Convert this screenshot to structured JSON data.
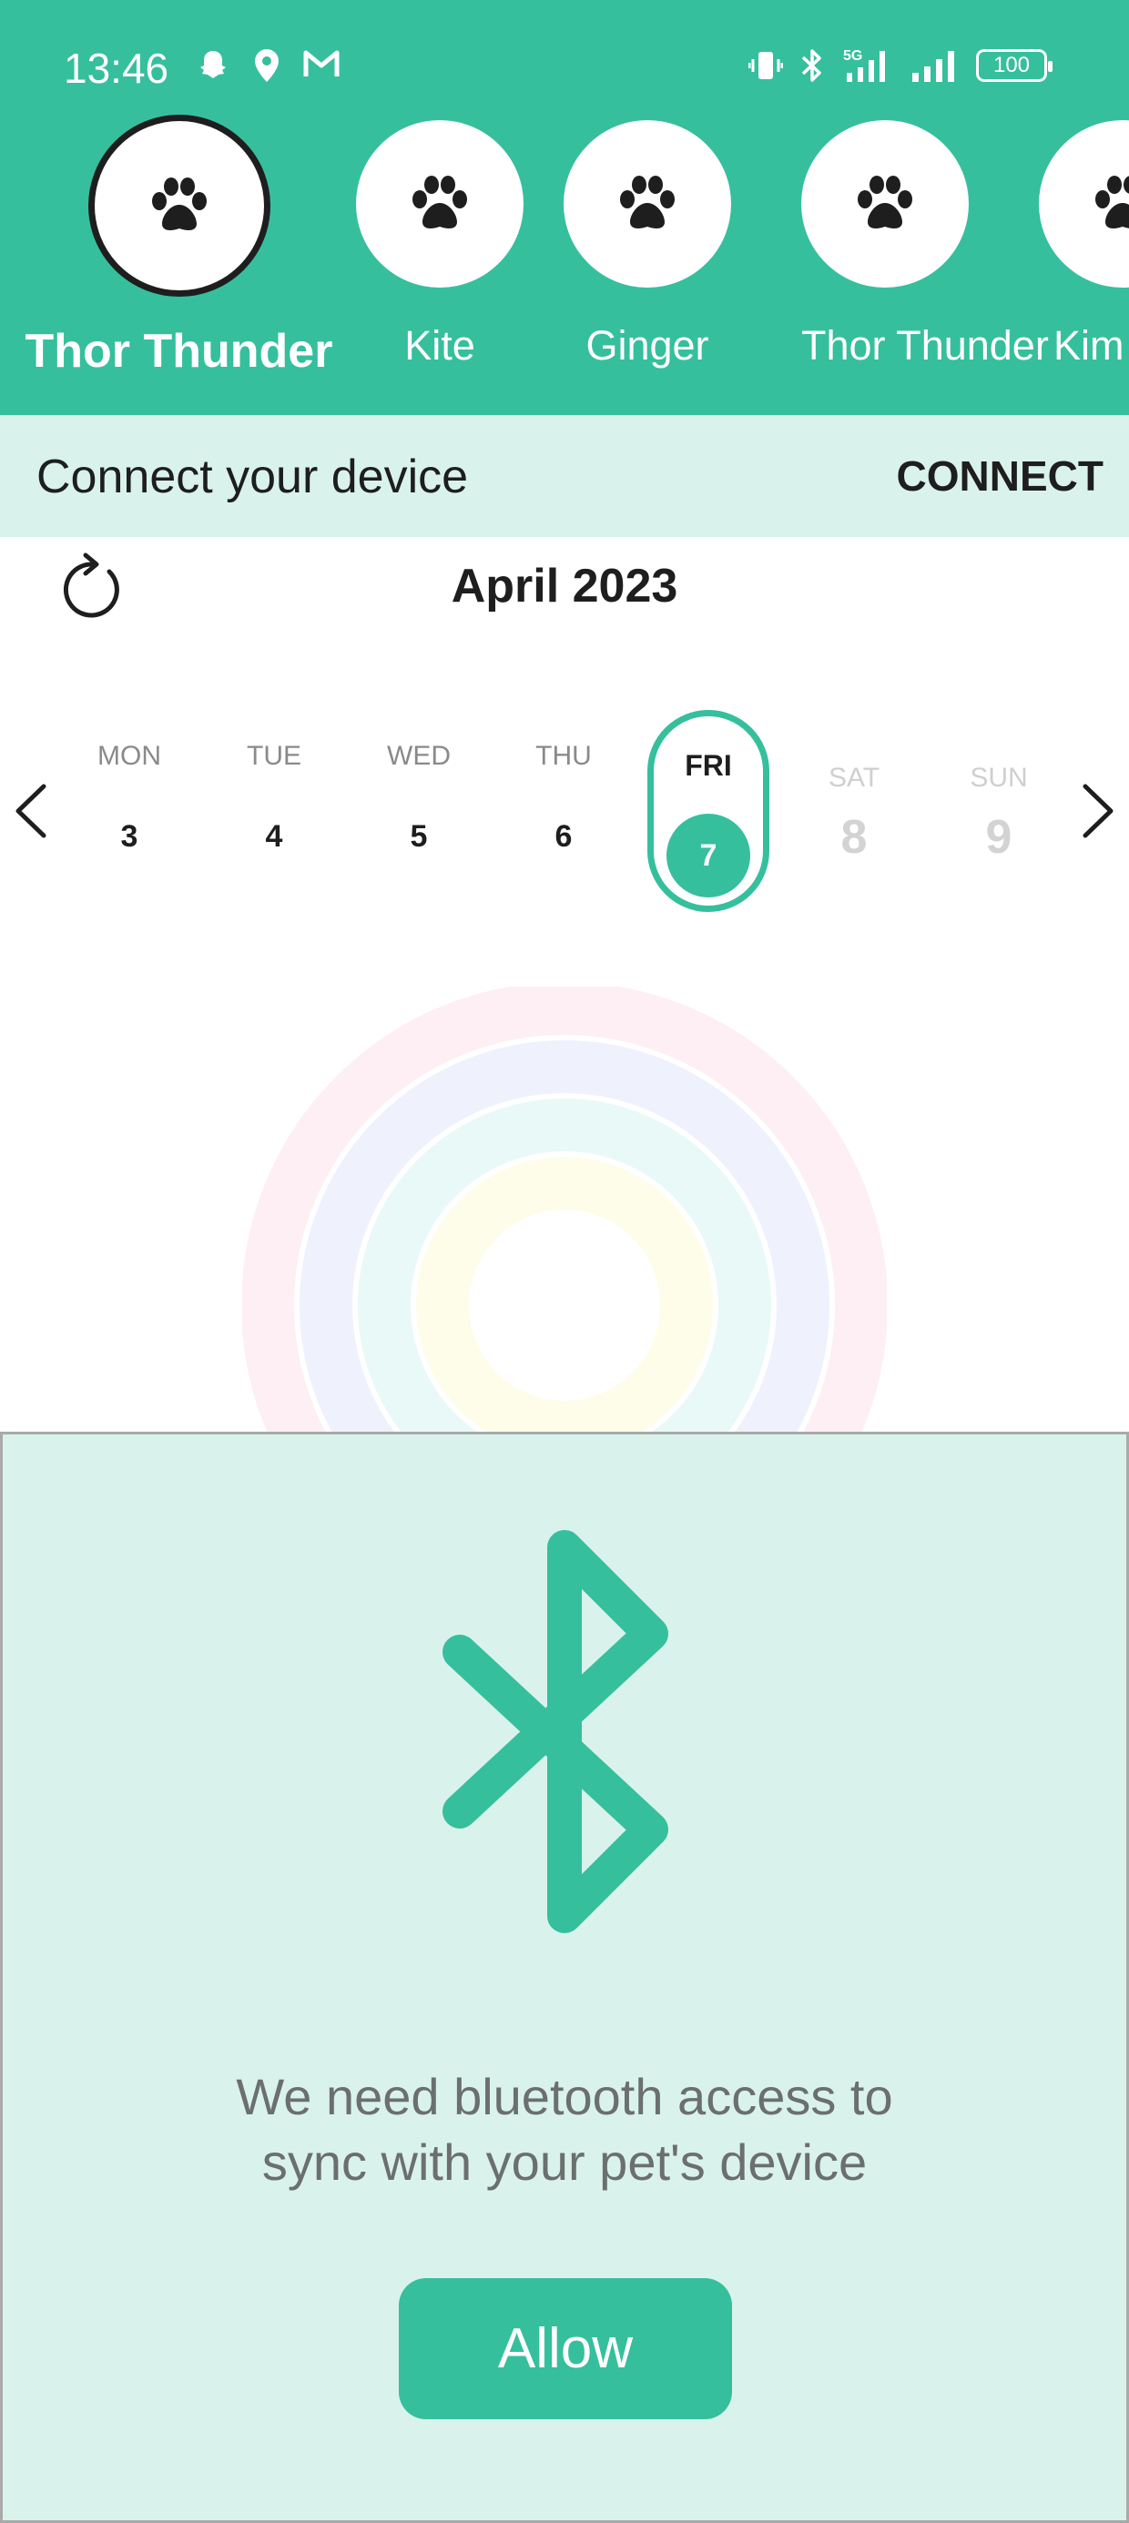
{
  "status_bar": {
    "time": "13:46",
    "left_icons": [
      "snapchat-icon",
      "location-pin-icon",
      "gmail-icon"
    ],
    "right_icons": [
      "vibrate-icon",
      "bluetooth-icon",
      "signal-5g-icon",
      "signal-icon"
    ],
    "network_label": "5G",
    "battery": "100"
  },
  "pets": [
    {
      "name": "Thor Thunder",
      "selected": true
    },
    {
      "name": "Kite"
    },
    {
      "name": "Ginger"
    },
    {
      "name": "Thor Thunder"
    },
    {
      "name": "Kim"
    }
  ],
  "connect_bar": {
    "text": "Connect your device",
    "button": "CONNECT"
  },
  "calendar": {
    "month": "April 2023",
    "days": [
      {
        "name": "MON",
        "num": "3"
      },
      {
        "name": "TUE",
        "num": "4"
      },
      {
        "name": "WED",
        "num": "5"
      },
      {
        "name": "THU",
        "num": "6"
      },
      {
        "name": "FRI",
        "num": "7"
      },
      {
        "name": "SAT",
        "num": "8"
      },
      {
        "name": "SUN",
        "num": "9"
      }
    ]
  },
  "activity_rings": {
    "colors": [
      "#fdeff3",
      "#eff1fd",
      "#e9f9f7",
      "#fdfde9"
    ]
  },
  "modal": {
    "icon": "bluetooth-icon",
    "message_line1": "We need bluetooth access to",
    "message_line2": "sync with your pet's device",
    "allow_button": "Allow"
  },
  "colors": {
    "accent": "#36bf9d",
    "accent_light": "#d9f3ec",
    "text": "#1e1e1e"
  }
}
